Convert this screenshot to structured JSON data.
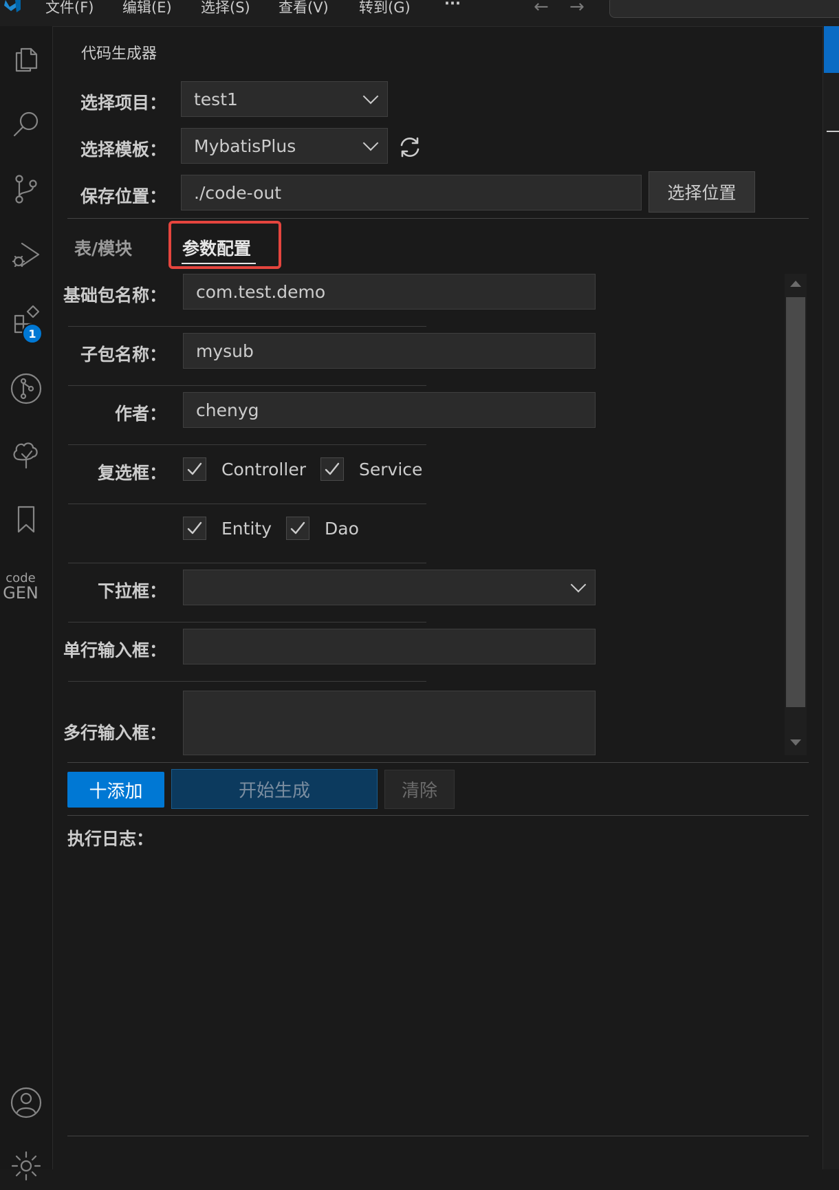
{
  "menubar": {
    "items": [
      "文件(F)",
      "编辑(E)",
      "选择(S)",
      "查看(V)",
      "转到(G)",
      "···"
    ],
    "back_arrow": "←",
    "forward_arrow": "→"
  },
  "activitybar": {
    "icons": [
      "explorer-icon",
      "search-icon",
      "source-control-icon",
      "run-debug-icon",
      "extensions-icon",
      "git-graph-icon",
      "tree-icon",
      "bookmark-icon"
    ],
    "extensions_badge": "1",
    "codegen": {
      "line1": "code",
      "line2": "GEN"
    },
    "bottom_icons": [
      "account-icon",
      "settings-gear-icon"
    ]
  },
  "panel": {
    "title": "代码生成器",
    "project": {
      "label": "选择项目：",
      "value": "test1"
    },
    "template": {
      "label": "选择模板：",
      "value": "MybatisPlus"
    },
    "save": {
      "label": "保存位置：",
      "value": "./code-out",
      "button": "选择位置"
    }
  },
  "tabs": {
    "table_module": "表/模块",
    "param_config": "参数配置",
    "active": "参数配置"
  },
  "form": {
    "base_package": {
      "label": "基础包名称：",
      "value": "com.test.demo"
    },
    "sub_package": {
      "label": "子包名称：",
      "value": "mysub"
    },
    "author": {
      "label": "作者：",
      "value": "chenyg"
    },
    "checkbox": {
      "label": "复选框：",
      "options": [
        {
          "name": "Controller",
          "checked": true
        },
        {
          "name": "Service",
          "checked": true
        },
        {
          "name": "Entity",
          "checked": true
        },
        {
          "name": "Dao",
          "checked": true
        }
      ]
    },
    "dropdown": {
      "label": "下拉框：",
      "value": ""
    },
    "single_input": {
      "label": "单行输入框：",
      "value": ""
    },
    "multi_input": {
      "label": "多行输入框：",
      "value": ""
    }
  },
  "actions": {
    "add": "十添加",
    "start": "开始生成",
    "clear": "清除"
  },
  "log": {
    "label": "执行日志：",
    "content": ""
  },
  "colors": {
    "accent": "#0078d4",
    "highlight_box": "#e5453e",
    "background": "#1a1a1a"
  }
}
